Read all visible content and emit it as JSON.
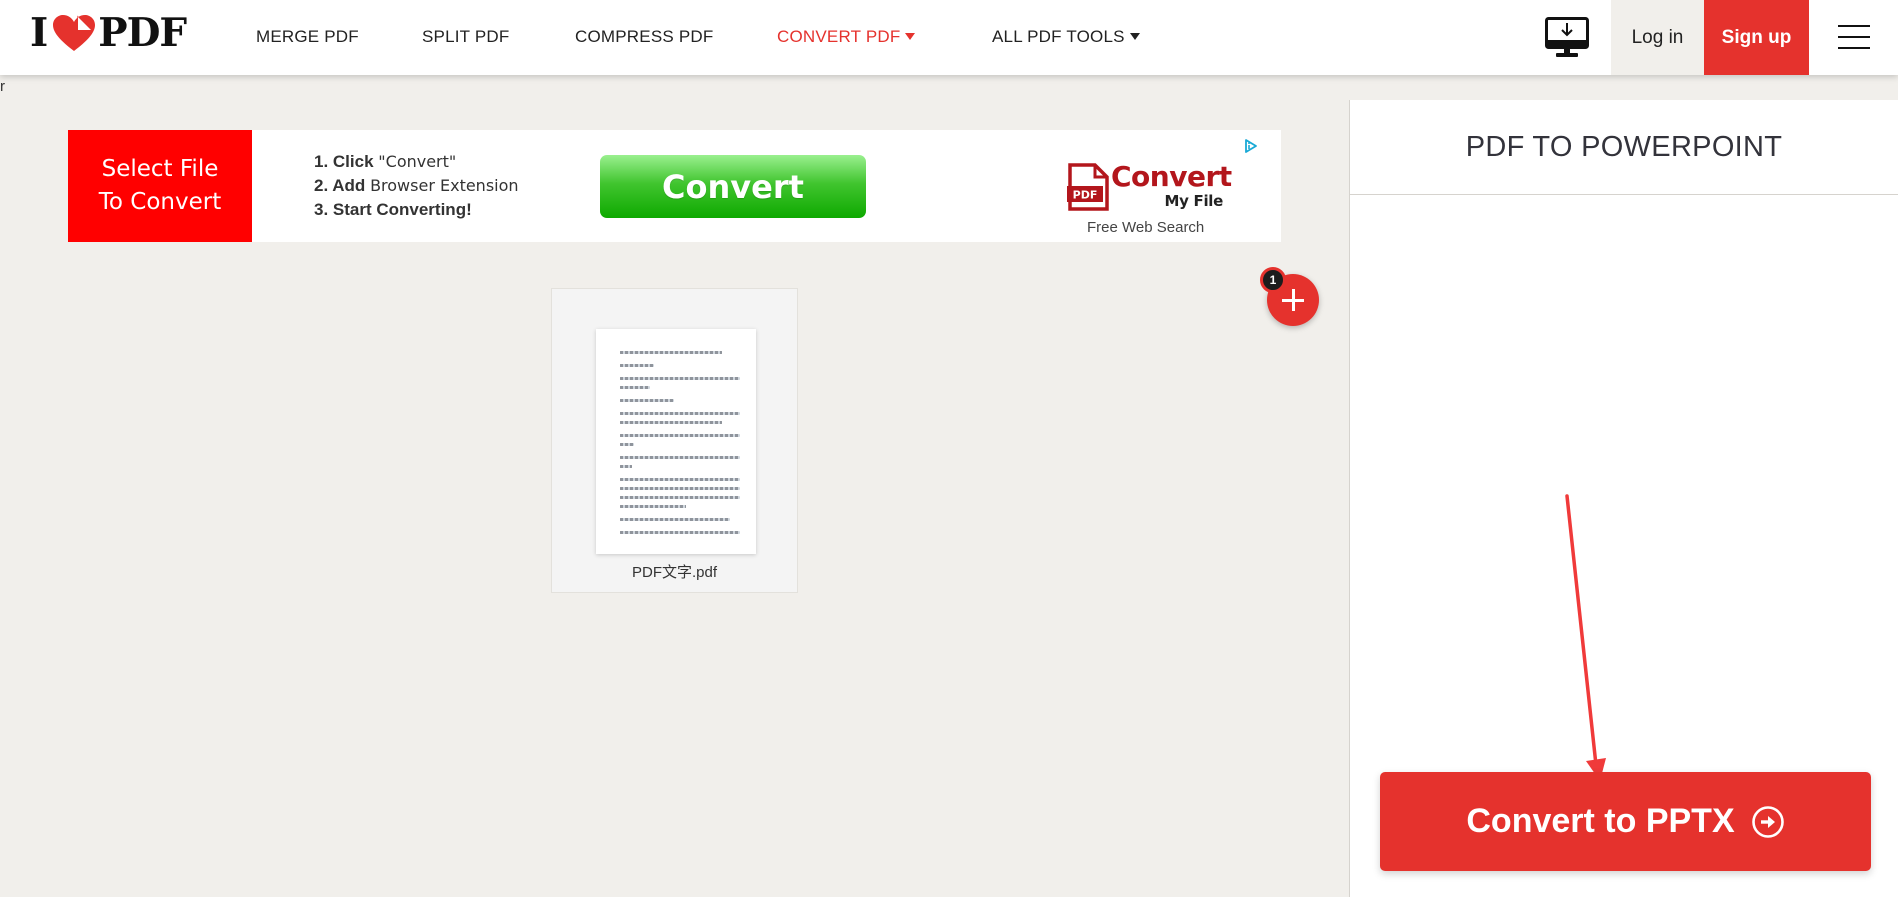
{
  "header": {
    "logo": {
      "prefix": "I",
      "suffix": "PDF"
    },
    "nav": [
      {
        "label": "MERGE PDF",
        "active": false,
        "dropdown": false
      },
      {
        "label": "SPLIT PDF",
        "active": false,
        "dropdown": false
      },
      {
        "label": "COMPRESS PDF",
        "active": false,
        "dropdown": false
      },
      {
        "label": "CONVERT PDF",
        "active": true,
        "dropdown": true
      },
      {
        "label": "ALL PDF TOOLS",
        "active": false,
        "dropdown": true
      }
    ],
    "desktop_icon": "desktop-download-icon",
    "login_label": "Log in",
    "signup_label": "Sign up",
    "menu_icon": "hamburger-menu-icon"
  },
  "stray_text": "r",
  "ad": {
    "cta_line1": "Select File",
    "cta_line2": "To Convert",
    "steps": [
      {
        "bold": "1. Click",
        "text": "\"Convert\""
      },
      {
        "bold": "2. Add",
        "text": "Browser Extension"
      },
      {
        "bold": "3. Start Converting!",
        "text": ""
      }
    ],
    "button_label": "Convert",
    "brand_badge": "PDF",
    "brand_word": "Convert",
    "brand_sub": "My File",
    "tagline": "Free Web Search",
    "adchoices_icon": "adchoices-icon"
  },
  "files": [
    {
      "name": "PDF文字.pdf"
    }
  ],
  "file_count_badge": "1",
  "sidebar": {
    "title": "PDF TO POWERPOINT",
    "convert_button_label": "Convert to PPTX"
  },
  "colors": {
    "brand_red": "#e5322d",
    "page_bg": "#f1efeb",
    "ad_red": "#ff0000",
    "ad_green": "#0ea900"
  }
}
